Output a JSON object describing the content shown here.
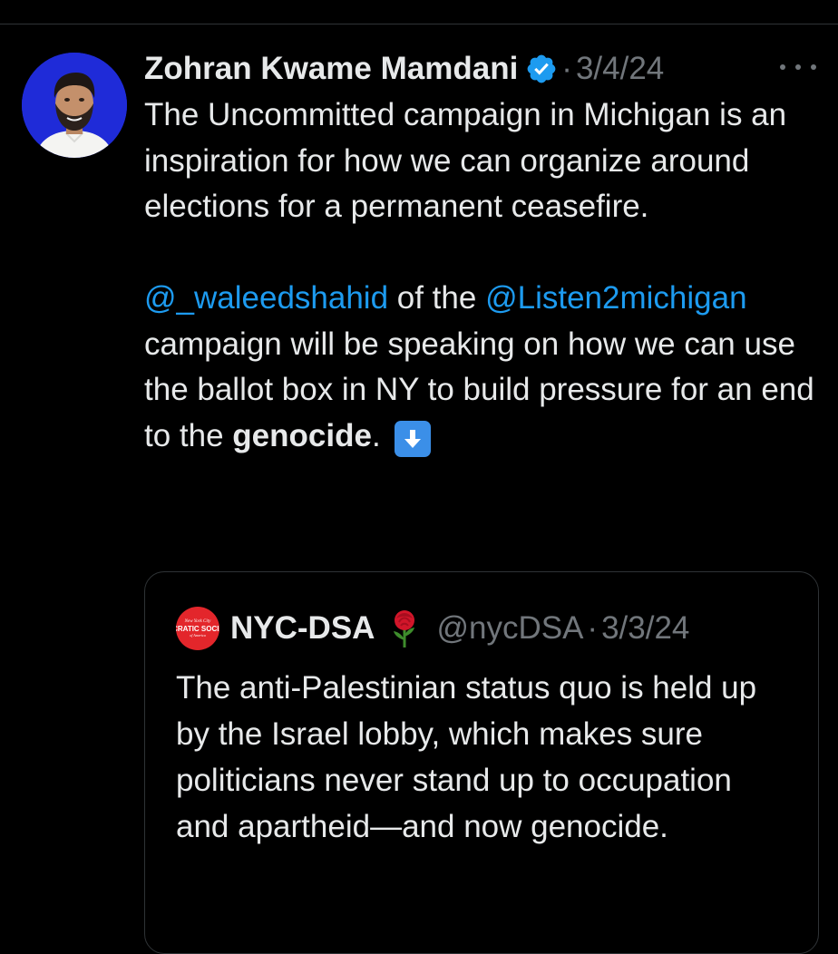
{
  "tweet": {
    "display_name": "Zohran Kwame Mamdani",
    "separator": "·",
    "timestamp": "3/4/24",
    "paragraph1": "The Uncommitted campaign in Michigan is an inspiration for how we can organize around elections for a permanent ceasefire.",
    "mention1": "@_waleedshahid",
    "text_after_mention1": " of the ",
    "mention2": "@Listen2michigan",
    "text_after_mention2": " campaign will be speaking on how we can use the ballot box in NY to build pressure for an end to the ",
    "bold_word": "genocide",
    "text_end": ". ",
    "emoji": "down-arrow-emoji"
  },
  "quote": {
    "avatar_lines": [
      "New York City",
      "DEMOCRATIC SOCIALISTS",
      "of America"
    ],
    "display_name": "NYC-DSA",
    "emoji": "rose-emoji",
    "handle": "@nycDSA",
    "separator": "·",
    "timestamp": "3/3/24",
    "text": "The anti-Palestinian status quo is held up by the Israel lobby, which makes sure politicians never stand up to occupation and apartheid—and now genocide."
  },
  "icons": {
    "verified": "verified-badge-icon",
    "more": "more-options-icon"
  },
  "colors": {
    "background": "#000000",
    "text": "#e7e9ea",
    "muted": "#71767b",
    "link": "#1d9bf0",
    "verified": "#1d9bf0",
    "avatar_bg": "#1f2bd8",
    "dsa_red": "#e3262b",
    "emoji_blue": "#3b8fe8"
  }
}
